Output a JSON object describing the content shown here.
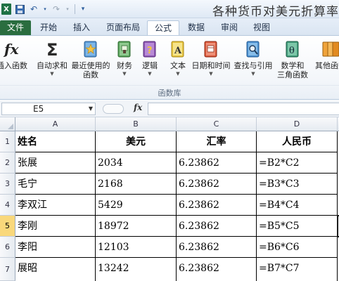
{
  "titlebar": {
    "app_icon": "X",
    "title": "各种货币对美元折算率"
  },
  "tabs": [
    "文件",
    "开始",
    "插入",
    "页面布局",
    "公式",
    "数据",
    "审阅",
    "视图"
  ],
  "active_tab": "公式",
  "ribbon": {
    "group_label": "函数库",
    "buttons": [
      {
        "label": "插入函数",
        "label2": "",
        "icon": "fx-icon"
      },
      {
        "label": "自动求和",
        "label2": "",
        "icon": "sigma-icon"
      },
      {
        "label": "最近使用的",
        "label2": "函数",
        "icon": "recent-book-icon"
      },
      {
        "label": "财务",
        "label2": "",
        "icon": "finance-book-icon"
      },
      {
        "label": "逻辑",
        "label2": "",
        "icon": "logic-book-icon"
      },
      {
        "label": "文本",
        "label2": "",
        "icon": "text-book-icon"
      },
      {
        "label": "日期和时间",
        "label2": "",
        "icon": "datetime-book-icon"
      },
      {
        "label": "查找与引用",
        "label2": "",
        "icon": "lookup-book-icon"
      },
      {
        "label": "数学和",
        "label2": "三角函数",
        "icon": "math-book-icon"
      },
      {
        "label": "其他函数",
        "label2": "",
        "icon": "more-book-icon"
      }
    ]
  },
  "formula_bar": {
    "name_box": "E5",
    "fx_label": "fx",
    "formula": ""
  },
  "sheet": {
    "columns": [
      "A",
      "B",
      "C",
      "D"
    ],
    "row_numbers": [
      "1",
      "2",
      "3",
      "4",
      "5",
      "6",
      "7"
    ],
    "selected_row": "5",
    "rows": [
      [
        "姓名",
        "美元",
        "汇率",
        "人民币"
      ],
      [
        "张展",
        "2034",
        "6.23862",
        "=B2*C2"
      ],
      [
        "毛宁",
        "2168",
        "6.23862",
        "=B3*C3"
      ],
      [
        "李双江",
        "5429",
        "6.23862",
        "=B4*C4"
      ],
      [
        "李刚",
        "18972",
        "6.23862",
        "=B5*C5"
      ],
      [
        "李阳",
        "12103",
        "6.23862",
        "=B6*C6"
      ],
      [
        "展昭",
        "13242",
        "6.23862",
        "=B7*C7"
      ]
    ]
  }
}
